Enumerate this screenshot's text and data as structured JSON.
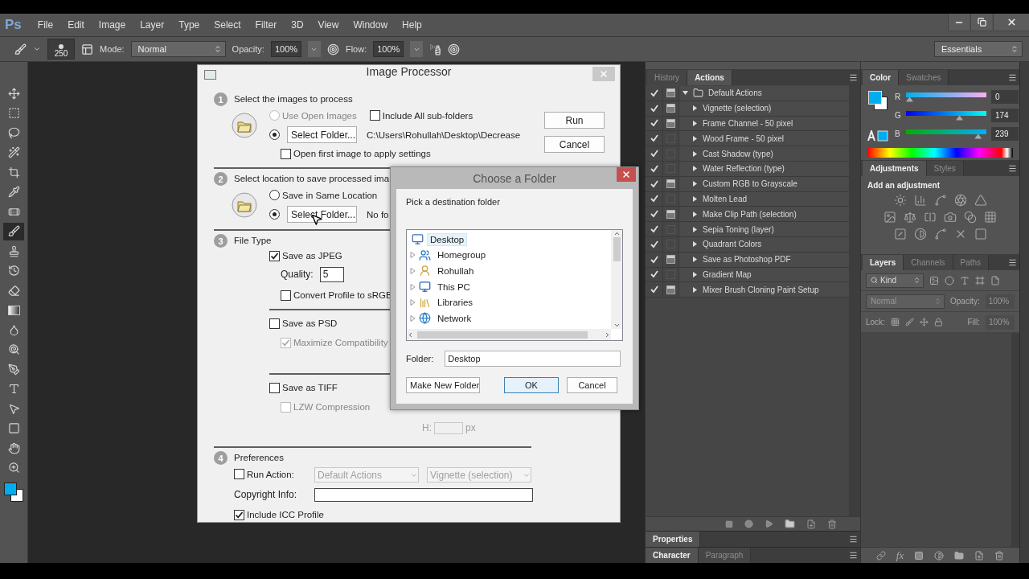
{
  "app": {
    "logo": "Ps"
  },
  "menu": [
    "File",
    "Edit",
    "Image",
    "Layer",
    "Type",
    "Select",
    "Filter",
    "3D",
    "View",
    "Window",
    "Help"
  ],
  "options_bar": {
    "brush_size": "250",
    "mode_label": "Mode:",
    "mode": "Normal",
    "opacity_label": "Opacity:",
    "opacity": "100%",
    "flow_label": "Flow:",
    "flow": "100%",
    "workspace": "Essentials"
  },
  "tools": [
    {
      "kind": "move",
      "selected": false
    },
    {
      "kind": "marquee",
      "selected": false
    },
    {
      "kind": "lasso",
      "selected": false
    },
    {
      "kind": "wand",
      "selected": false
    },
    {
      "kind": "crop",
      "selected": false
    },
    {
      "kind": "eyedropper",
      "selected": false
    },
    {
      "kind": "healing",
      "selected": false
    },
    {
      "kind": "brush",
      "selected": true
    },
    {
      "kind": "stamp",
      "selected": false
    },
    {
      "kind": "history",
      "selected": false
    },
    {
      "kind": "eraser",
      "selected": false
    },
    {
      "kind": "gradient",
      "selected": false
    },
    {
      "kind": "blur",
      "selected": false
    },
    {
      "kind": "dodge",
      "selected": false
    },
    {
      "kind": "pen",
      "selected": false
    },
    {
      "kind": "type",
      "selected": false
    },
    {
      "kind": "path",
      "selected": false
    },
    {
      "kind": "shape",
      "selected": false
    },
    {
      "kind": "hand",
      "selected": false
    },
    {
      "kind": "zoom",
      "selected": false
    }
  ],
  "image_processor": {
    "title": "Image Processor",
    "buttons": [
      "Run",
      "Cancel"
    ],
    "source": {
      "number": "1",
      "title": "Select the images to process",
      "use_open": {
        "label": "Use Open Images",
        "selected": false,
        "disabled": true
      },
      "include_sub": {
        "label": "Include All sub-folders",
        "checked": false
      },
      "folder": {
        "selected": true,
        "button": "Select Folder...",
        "path": "C:\\Users\\Rohullah\\Desktop\\Decrease"
      },
      "open_first": {
        "label": "Open first image to apply settings",
        "checked": false
      }
    },
    "destination": {
      "number": "2",
      "title": "Select location to save processed ima",
      "same_location": {
        "label": "Save in Same Location",
        "selected": false
      },
      "folder": {
        "selected": true,
        "button": "Select Folder...",
        "path": "No fo"
      }
    },
    "file_type": {
      "number": "3",
      "title": "File Type",
      "groups": [
        {
          "label": "Save as JPEG",
          "checked": true,
          "children": [
            {
              "kind": "field",
              "label": "Quality:",
              "value": "5"
            },
            {
              "kind": "checkbox",
              "label": "Convert Profile to sRGB",
              "checked": false,
              "disabled": false
            }
          ]
        },
        {
          "label": "Save as PSD",
          "checked": false,
          "children": [
            {
              "kind": "checkbox",
              "label": "Maximize Compatibility",
              "checked": true,
              "disabled": true
            }
          ]
        },
        {
          "label": "Save as TIFF",
          "checked": false,
          "children": [
            {
              "kind": "checkbox",
              "label": "LZW Compression",
              "checked": false,
              "disabled": true
            },
            {
              "kind": "size",
              "label": "H:",
              "unit": "px"
            }
          ]
        }
      ]
    },
    "preferences": {
      "number": "4",
      "title": "Preferences",
      "run_action": {
        "label": "Run Action:",
        "checked": false,
        "set": "Default Actions",
        "action": "Vignette (selection)"
      },
      "copyright": {
        "label": "Copyright Info:"
      },
      "icc": {
        "label": "Include ICC Profile",
        "checked": true
      }
    }
  },
  "choose_folder": {
    "title": "Choose a Folder",
    "prompt": "Pick a destination folder",
    "tree": [
      {
        "kind": "desktop",
        "label": "Desktop",
        "selected": true,
        "children": [
          {
            "kind": "homegroup",
            "label": "Homegroup",
            "selected": false,
            "expanded": false
          },
          {
            "kind": "user",
            "label": "Rohullah",
            "selected": false,
            "expanded": false
          },
          {
            "kind": "computer",
            "label": "This PC",
            "selected": false,
            "expanded": false
          },
          {
            "kind": "libraries",
            "label": "Libraries",
            "selected": false,
            "expanded": false
          },
          {
            "kind": "network",
            "label": "Network",
            "selected": false,
            "expanded": false
          }
        ]
      }
    ],
    "folder_label": "Folder:",
    "folder_value": "Desktop",
    "buttons": [
      {
        "label": "Make New Folder",
        "default": false
      },
      {
        "label": "OK",
        "default": true
      },
      {
        "label": "Cancel",
        "default": false
      }
    ]
  },
  "actions_panel": {
    "tabs": [
      {
        "label": "History",
        "selected": false
      },
      {
        "label": "Actions",
        "selected": true
      }
    ],
    "sets": [
      {
        "label": "Default Actions",
        "enabled": true,
        "dialog": true,
        "expanded": true,
        "children": [
          {
            "label": "Vignette (selection)",
            "enabled": true,
            "dialog": true,
            "expanded": false
          },
          {
            "label": "Frame Channel - 50 pixel",
            "enabled": true,
            "dialog": true,
            "expanded": false
          },
          {
            "label": "Wood Frame - 50 pixel",
            "enabled": true,
            "dialog": false,
            "expanded": false
          },
          {
            "label": "Cast Shadow (type)",
            "enabled": true,
            "dialog": false,
            "expanded": false
          },
          {
            "label": "Water Reflection (type)",
            "enabled": true,
            "dialog": false,
            "expanded": false
          },
          {
            "label": "Custom RGB to Grayscale",
            "enabled": true,
            "dialog": true,
            "expanded": false
          },
          {
            "label": "Molten Lead",
            "enabled": true,
            "dialog": false,
            "expanded": false
          },
          {
            "label": "Make Clip Path (selection)",
            "enabled": true,
            "dialog": true,
            "expanded": false
          },
          {
            "label": "Sepia Toning (layer)",
            "enabled": true,
            "dialog": false,
            "expanded": false
          },
          {
            "label": "Quadrant Colors",
            "enabled": true,
            "dialog": false,
            "expanded": false
          },
          {
            "label": "Save as Photoshop PDF",
            "enabled": true,
            "dialog": true,
            "expanded": false
          },
          {
            "label": "Gradient Map",
            "enabled": true,
            "dialog": false,
            "expanded": false
          },
          {
            "label": "Mixer Brush Cloning Paint Setup",
            "enabled": true,
            "dialog": true,
            "expanded": false
          }
        ]
      }
    ]
  },
  "properties_panel": {
    "tabs": [
      {
        "label": "Properties",
        "selected": true
      }
    ]
  },
  "character_panel": {
    "tabs": [
      {
        "label": "Character",
        "selected": true
      },
      {
        "label": "Paragraph",
        "selected": false
      }
    ]
  },
  "color_panel": {
    "tabs": [
      {
        "label": "Color",
        "selected": true
      },
      {
        "label": "Swatches",
        "selected": false
      }
    ],
    "channels": [
      {
        "name": "R",
        "value": "0",
        "level": 0
      },
      {
        "name": "G",
        "value": "174",
        "level": 0.682
      },
      {
        "name": "B",
        "value": "239",
        "level": 0.937
      }
    ]
  },
  "adjustments_panel": {
    "tabs": [
      {
        "label": "Adjustments",
        "selected": true
      },
      {
        "label": "Styles",
        "selected": false
      }
    ],
    "heading": "Add an adjustment"
  },
  "layers_panel": {
    "tabs": [
      {
        "label": "Layers",
        "selected": true
      },
      {
        "label": "Channels",
        "selected": false
      },
      {
        "label": "Paths",
        "selected": false
      }
    ],
    "filter": "Kind",
    "blend_mode": "Normal",
    "opacity_label": "Opacity:",
    "opacity": "100%",
    "lock_label": "Lock:",
    "fill_label": "Fill:",
    "fill": "100%",
    "controls_disabled": true,
    "fx_label": "fx"
  }
}
